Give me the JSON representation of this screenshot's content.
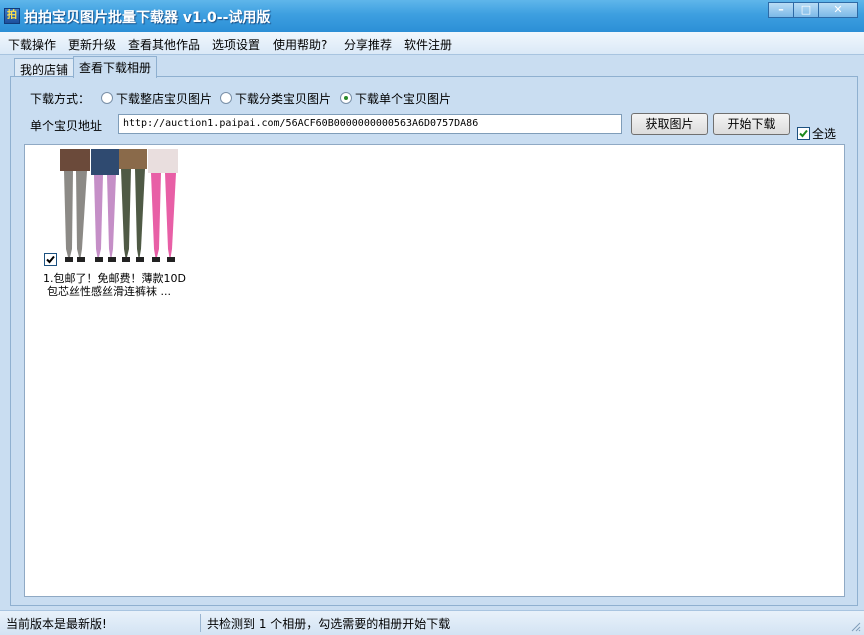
{
  "window": {
    "title": "拍拍宝贝图片批量下载器 v1.0--试用版",
    "app_icon_glyph": "拍",
    "minimize_glyph": "–",
    "maximize_glyph": "□",
    "close_glyph": "✕"
  },
  "menu": {
    "items": [
      "下载操作",
      "更新升级",
      "查看其他作品",
      "选项设置",
      "使用帮助?",
      "分享推荐",
      "软件注册"
    ]
  },
  "tabs": [
    "我的店铺",
    "查看下载相册"
  ],
  "active_tab": 1,
  "options": {
    "mode_label": "下载方式：",
    "modes": [
      "下载整店宝贝图片",
      "下载分类宝贝图片",
      "下载单个宝贝图片"
    ],
    "selected_mode": 2,
    "url_label": "单个宝贝地址",
    "url_value": "http://auction1.paipai.com/56ACF60B0000000000563A6D0757DA86",
    "get_images_button": "获取图片",
    "start_download_button": "开始下载",
    "select_all_label": "全选",
    "select_all_checked": true
  },
  "gallery": {
    "items": [
      {
        "caption_line1": "1.包邮了！免邮费！薄款10D",
        "caption_line2": "包芯丝性感丝滑连裤袜 ...",
        "checked": true
      }
    ]
  },
  "status": {
    "left": "当前版本是最新版!",
    "right": "共检测到 1 个相册，勾选需要的相册开始下载"
  },
  "colors": {
    "titlebar": "#3d9fe0",
    "panel": "#c9ddf1",
    "radio_dot": "#2a8a2a"
  }
}
